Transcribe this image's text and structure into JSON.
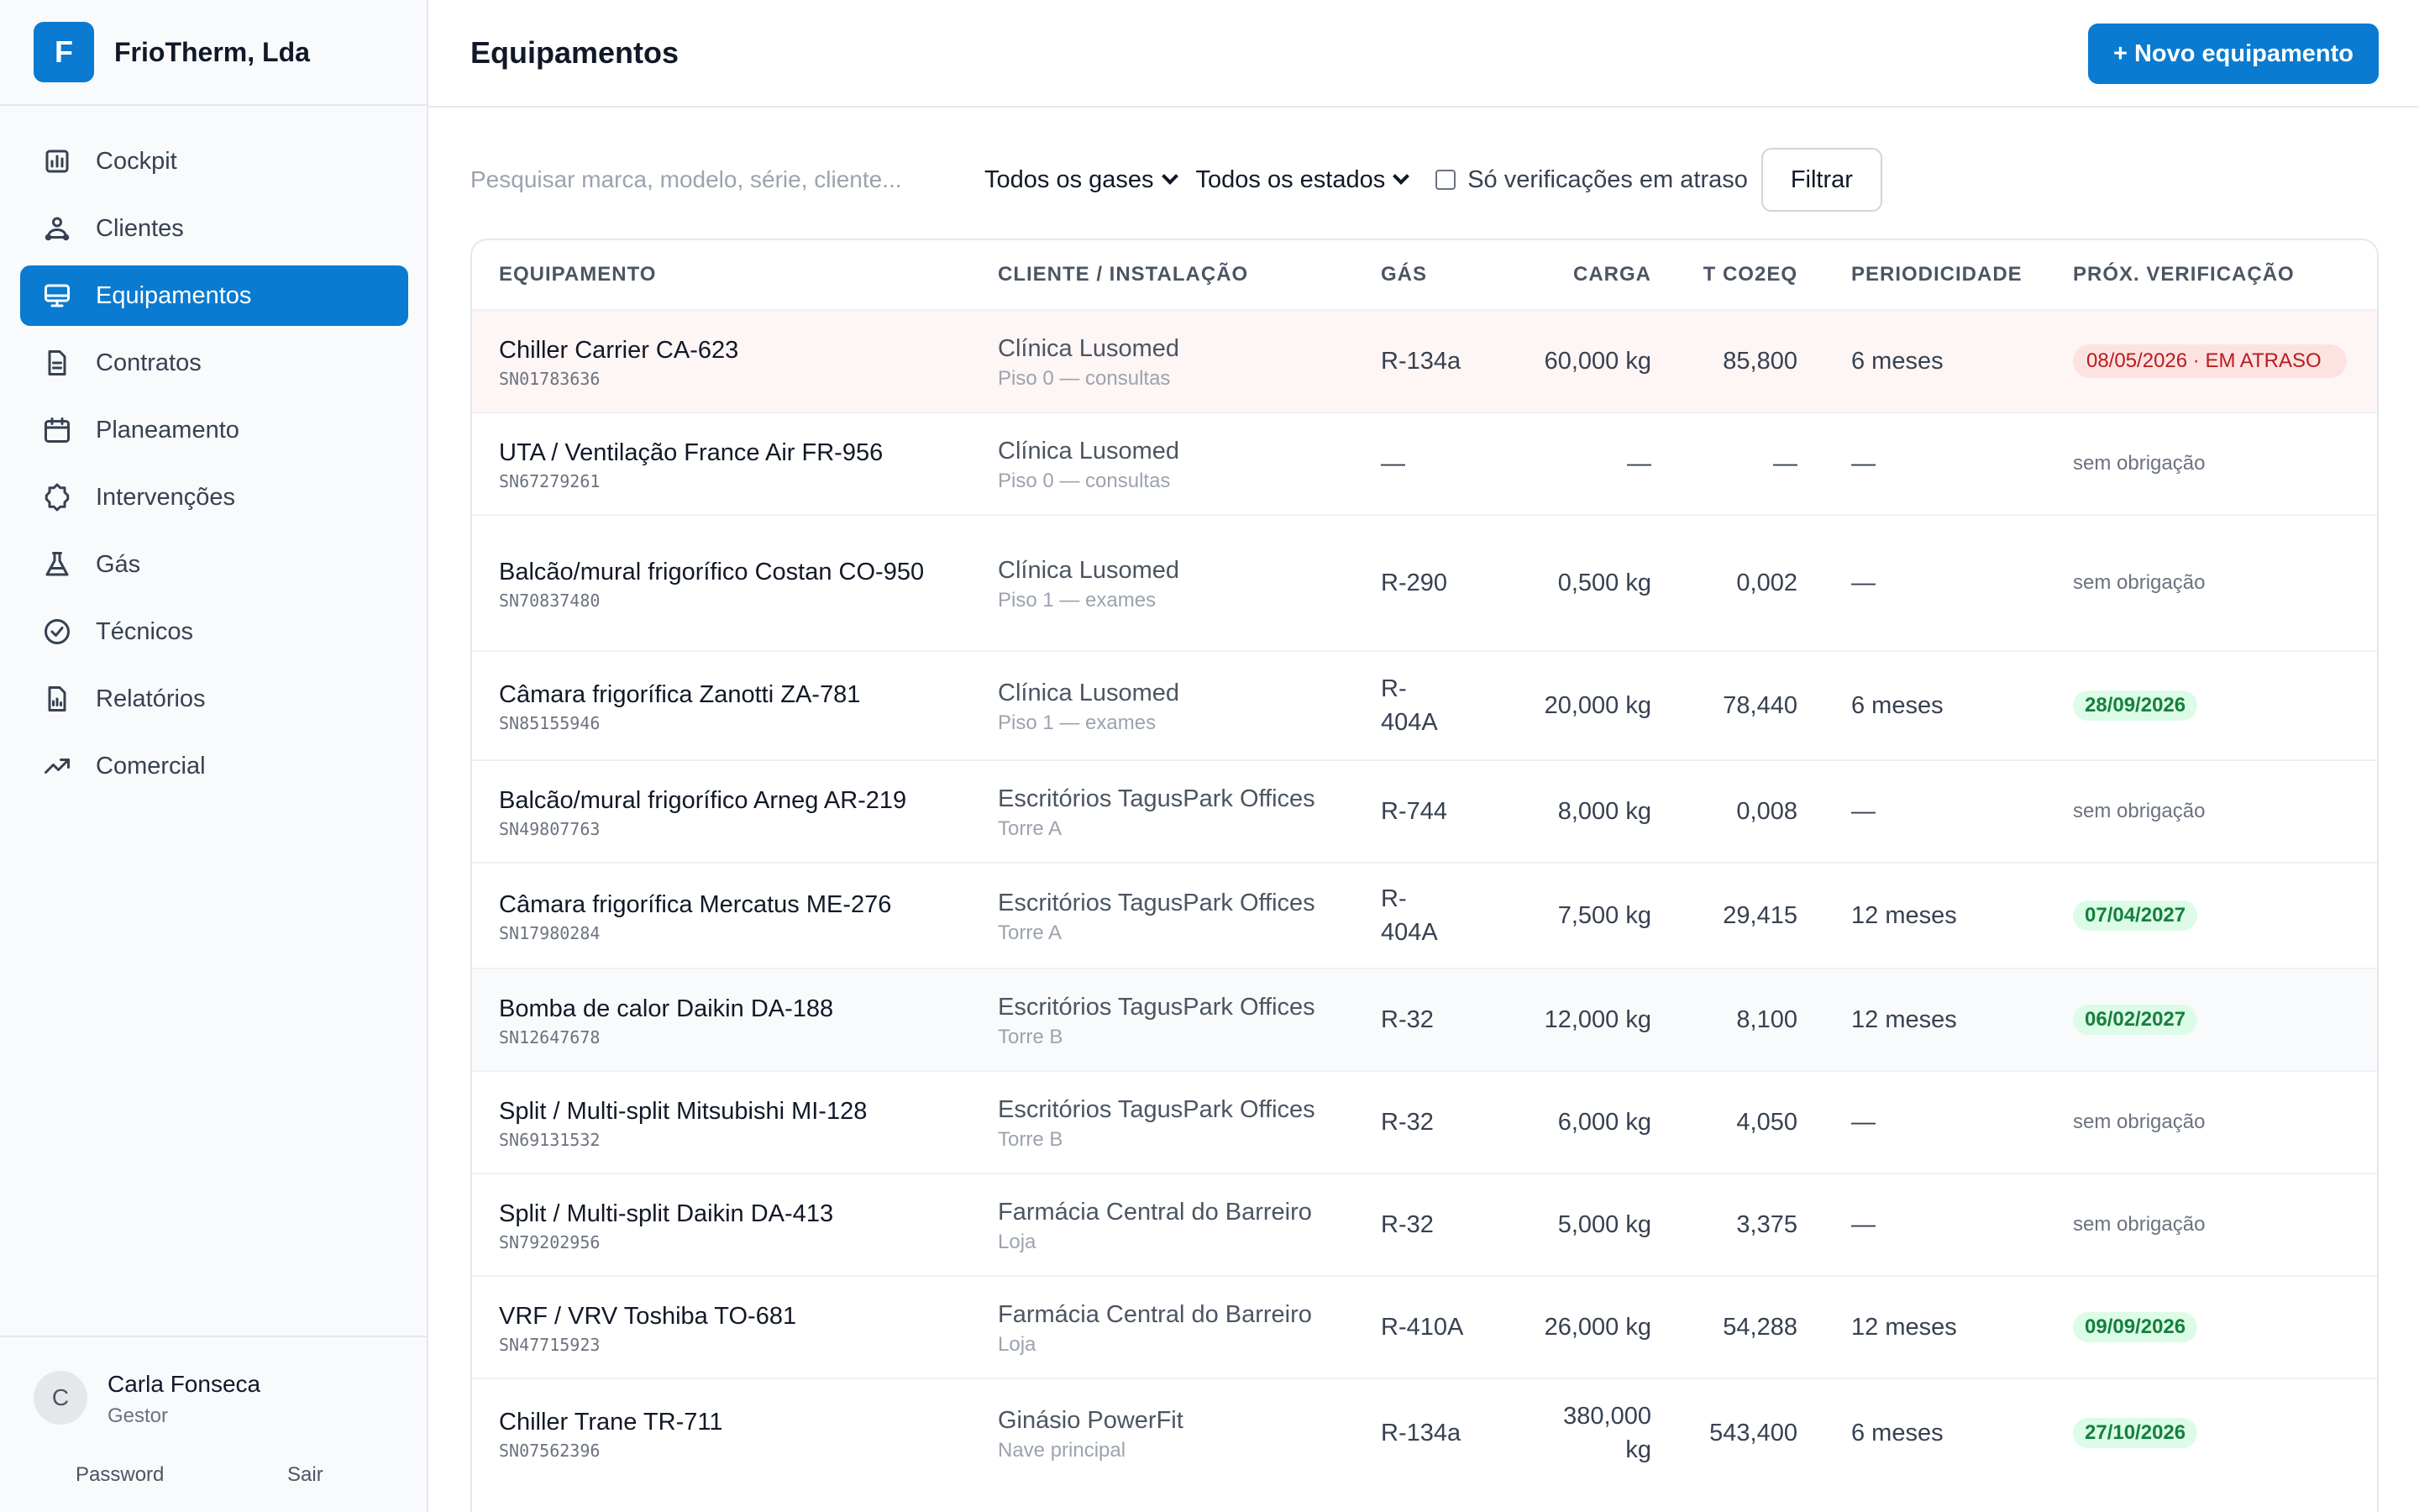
{
  "brand": {
    "initial": "F",
    "name": "FrioTherm, Lda"
  },
  "nav": [
    {
      "label": "Cockpit",
      "icon": "bar-chart-icon",
      "active": false
    },
    {
      "label": "Clientes",
      "icon": "users-icon",
      "active": false
    },
    {
      "label": "Equipamentos",
      "icon": "monitor-icon",
      "active": true
    },
    {
      "label": "Contratos",
      "icon": "file-icon",
      "active": false
    },
    {
      "label": "Planeamento",
      "icon": "calendar-icon",
      "active": false
    },
    {
      "label": "Intervenções",
      "icon": "gear-icon",
      "active": false
    },
    {
      "label": "Gás",
      "icon": "flask-icon",
      "active": false
    },
    {
      "label": "Técnicos",
      "icon": "check-circle-icon",
      "active": false
    },
    {
      "label": "Relatórios",
      "icon": "report-icon",
      "active": false
    },
    {
      "label": "Comercial",
      "icon": "trend-icon",
      "active": false
    }
  ],
  "user": {
    "initial": "C",
    "name": "Carla Fonseca",
    "role": "Gestor",
    "password_label": "Password",
    "logout_label": "Sair"
  },
  "header": {
    "title": "Equipamentos",
    "new_button": "+ Novo equipamento"
  },
  "filters": {
    "search_placeholder": "Pesquisar marca, modelo, série, cliente...",
    "gas_select": "Todos os gases",
    "state_select": "Todos os estados",
    "overdue_label": "Só verificações em atraso",
    "filter_button": "Filtrar"
  },
  "table": {
    "headers": [
      "EQUIPAMENTO",
      "CLIENTE / INSTALAÇÃO",
      "GÁS",
      "CARGA",
      "T CO2EQ",
      "PERIODICIDADE",
      "PRÓX. VERIFICAÇÃO"
    ],
    "rows": [
      {
        "name": "Chiller Carrier CA-623",
        "serial": "SN01783636",
        "client": "Clínica Lusomed",
        "site": "Piso 0 — consultas",
        "gas": "R-134a",
        "charge": "60,000 kg",
        "co2": "85,800",
        "period": "6 meses",
        "next": "08/05/2026 · EM ATRASO",
        "status": "overdue"
      },
      {
        "name": "UTA / Ventilação France Air FR-956",
        "serial": "SN67279261",
        "client": "Clínica Lusomed",
        "site": "Piso 0 — consultas",
        "gas": "—",
        "charge": "—",
        "co2": "—",
        "period": "—",
        "next": "sem obrigação",
        "status": "none"
      },
      {
        "name": "Balcão/mural frigorífico Costan CO-950",
        "serial": "SN70837480",
        "client": "Clínica Lusomed",
        "site": "Piso 1 — exames",
        "gas": "R-290",
        "charge": "0,500 kg",
        "co2": "0,002",
        "period": "—",
        "next": "sem obrigação",
        "status": "none"
      },
      {
        "name": "Câmara frigorífica Zanotti ZA-781",
        "serial": "SN85155946",
        "client": "Clínica Lusomed",
        "site": "Piso 1 — exames",
        "gas": "R-404A",
        "charge": "20,000 kg",
        "co2": "78,440",
        "period": "6 meses",
        "next": "28/09/2026",
        "status": "ok"
      },
      {
        "name": "Balcão/mural frigorífico Arneg AR-219",
        "serial": "SN49807763",
        "client": "Escritórios TagusPark Offices",
        "site": "Torre A",
        "gas": "R-744",
        "charge": "8,000 kg",
        "co2": "0,008",
        "period": "—",
        "next": "sem obrigação",
        "status": "none"
      },
      {
        "name": "Câmara frigorífica Mercatus ME-276",
        "serial": "SN17980284",
        "client": "Escritórios TagusPark Offices",
        "site": "Torre A",
        "gas": "R-404A",
        "charge": "7,500 kg",
        "co2": "29,415",
        "period": "12 meses",
        "next": "07/04/2027",
        "status": "ok"
      },
      {
        "name": "Bomba de calor Daikin DA-188",
        "serial": "SN12647678",
        "client": "Escritórios TagusPark Offices",
        "site": "Torre B",
        "gas": "R-32",
        "charge": "12,000 kg",
        "co2": "8,100",
        "period": "12 meses",
        "next": "06/02/2027",
        "status": "ok"
      },
      {
        "name": "Split / Multi-split Mitsubishi MI-128",
        "serial": "SN69131532",
        "client": "Escritórios TagusPark Offices",
        "site": "Torre B",
        "gas": "R-32",
        "charge": "6,000 kg",
        "co2": "4,050",
        "period": "—",
        "next": "sem obrigação",
        "status": "none"
      },
      {
        "name": "Split / Multi-split Daikin DA-413",
        "serial": "SN79202956",
        "client": "Farmácia Central do Barreiro",
        "site": "Loja",
        "gas": "R-32",
        "charge": "5,000 kg",
        "co2": "3,375",
        "period": "—",
        "next": "sem obrigação",
        "status": "none"
      },
      {
        "name": "VRF / VRV Toshiba TO-681",
        "serial": "SN47715923",
        "client": "Farmácia Central do Barreiro",
        "site": "Loja",
        "gas": "R-410A",
        "charge": "26,000 kg",
        "co2": "54,288",
        "period": "12 meses",
        "next": "09/09/2026",
        "status": "ok"
      },
      {
        "name": "Chiller Trane TR-711",
        "serial": "SN07562396",
        "client": "Ginásio PowerFit",
        "site": "Nave principal",
        "gas": "R-134a",
        "charge": "380,000 kg",
        "co2": "543,400",
        "period": "6 meses",
        "next": "27/10/2026",
        "status": "ok"
      }
    ]
  },
  "colors": {
    "accent": "#0a7bd0",
    "overdue_bg": "#fde2e2",
    "ok_bg": "#dcfce7"
  }
}
